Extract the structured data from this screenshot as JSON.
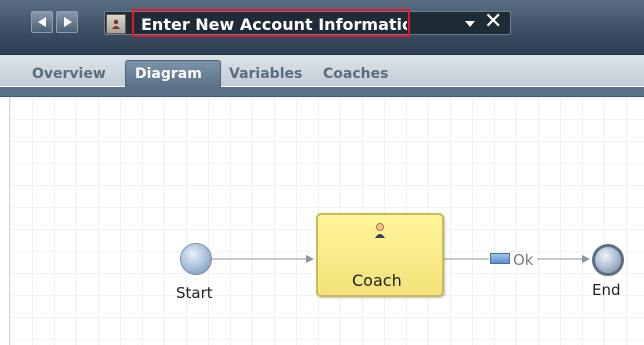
{
  "header": {
    "title": "Enter New Account Informatio",
    "icons": {
      "back": "left-arrow-icon",
      "forward": "right-arrow-icon",
      "doc": "process-icon",
      "dropdown": "chevron-down-icon",
      "close": "close-icon"
    },
    "close_glyph": "✕"
  },
  "tabs": [
    {
      "label": "Overview",
      "active": false
    },
    {
      "label": "Diagram",
      "active": true
    },
    {
      "label": "Variables",
      "active": false
    },
    {
      "label": "Coaches",
      "active": false
    }
  ],
  "diagram": {
    "start_label": "Start",
    "coach_label": "Coach",
    "end_label": "End",
    "flow_label": "Ok"
  },
  "colors": {
    "highlight": "#e2172b",
    "coach_fill": "#fff59a",
    "header": "#3c4f63"
  }
}
